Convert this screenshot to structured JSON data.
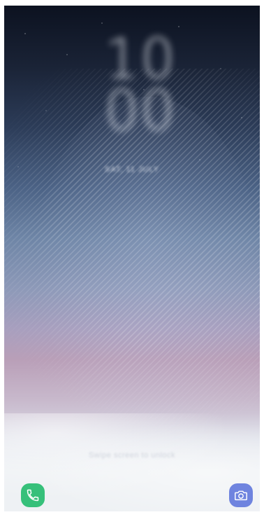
{
  "lockscreen": {
    "clock_hours": "10",
    "clock_minutes": "00",
    "date": "SAT, 11 JULY",
    "unlock_hint": "Swipe screen to unlock"
  },
  "shortcuts": {
    "left_icon": "phone-icon",
    "right_icon": "camera-icon",
    "left_color": "#36c07a",
    "right_color": "#6f84df"
  }
}
